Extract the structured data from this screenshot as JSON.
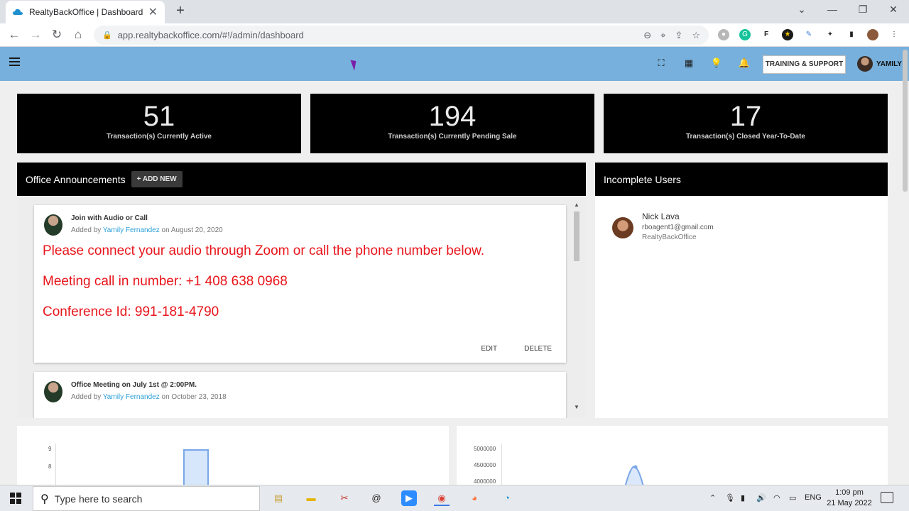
{
  "browser": {
    "tab_title": "RealtyBackOffice | Dashboard",
    "url": "app.realtybackoffice.com/#!/admin/dashboard"
  },
  "header": {
    "training_label": "TRAINING & SUPPORT",
    "user_name": "YAMILY"
  },
  "stats": [
    {
      "value": "51",
      "label": "Transaction(s) Currently Active"
    },
    {
      "value": "194",
      "label": "Transaction(s) Currently Pending Sale"
    },
    {
      "value": "17",
      "label": "Transaction(s) Closed Year-To-Date"
    }
  ],
  "announcements": {
    "title": "Office Announcements",
    "add_new": "ADD NEW",
    "items": [
      {
        "title": "Join with Audio or Call",
        "added_by_prefix": "Added by",
        "author": "Yamily Fernandez",
        "date_text": "on August 20, 2020",
        "lines": [
          "Please connect your audio through Zoom or call the phone number below.",
          "Meeting call in number: +1 408 638 0968",
          "Conference Id: 991-181-4790"
        ],
        "edit": "EDIT",
        "delete": "DELETE"
      },
      {
        "title": "Office Meeting on July 1st @ 2:00PM.",
        "added_by_prefix": "Added by",
        "author": "Yamily Fernandez",
        "date_text": "on October 23, 2018"
      }
    ]
  },
  "incomplete_users": {
    "title": "Incomplete Users",
    "users": [
      {
        "name": "Nick Lava",
        "email": "rboagent1@gmail.com",
        "office": "RealtyBackOffice"
      }
    ]
  },
  "charts": {
    "left_ticks": [
      "9",
      "8"
    ],
    "right_ticks": [
      "5000000",
      "4500000",
      "4000000"
    ]
  },
  "taskbar": {
    "search_placeholder": "Type here to search",
    "lang": "ENG",
    "time": "1:09 pm",
    "date": "21 May 2022"
  }
}
